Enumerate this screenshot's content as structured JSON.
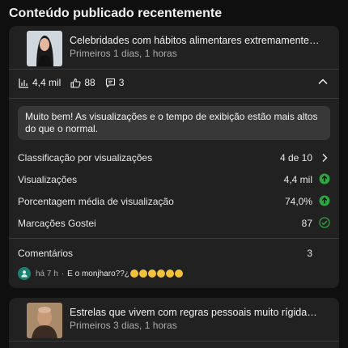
{
  "section": {
    "title": "Conteúdo publicado recentemente"
  },
  "videos": [
    {
      "title": "Celebridades com hábitos alimentares extremamente restritos #cu",
      "age": "Primeiros 1 dias, 1 horas",
      "stats": {
        "views": "4,4 mil",
        "likes": "88",
        "comments": "3"
      },
      "alert": "Muito bem! As visualizações e o tempo de exibição estão mais altos do que o normal.",
      "metrics": [
        {
          "label": "Classificação por visualizações",
          "value": "4 de 10",
          "icon": "chevron-right-icon"
        },
        {
          "label": "Visualizações",
          "value": "4,4 mil",
          "icon": "arrow-up-green-icon"
        },
        {
          "label": "Porcentagem média de visualização",
          "value": "74,0%",
          "icon": "arrow-up-green-icon"
        },
        {
          "label": "Marcações Gostei",
          "value": "87",
          "icon": "check-circle-icon"
        }
      ],
      "comments_section": {
        "label": "Comentários",
        "count": "3",
        "latest": {
          "time": "há 7 h",
          "text": "E o monjharo??¿"
        }
      }
    },
    {
      "title": "Estrelas que vivem com regras pessoais muito rígidas #curio",
      "age": "Primeiros 3 dias, 1 horas"
    }
  ],
  "colors": {
    "background": "#0f0f0f",
    "card": "#212121",
    "alert": "#383838",
    "accent_green": "#2ba640"
  }
}
